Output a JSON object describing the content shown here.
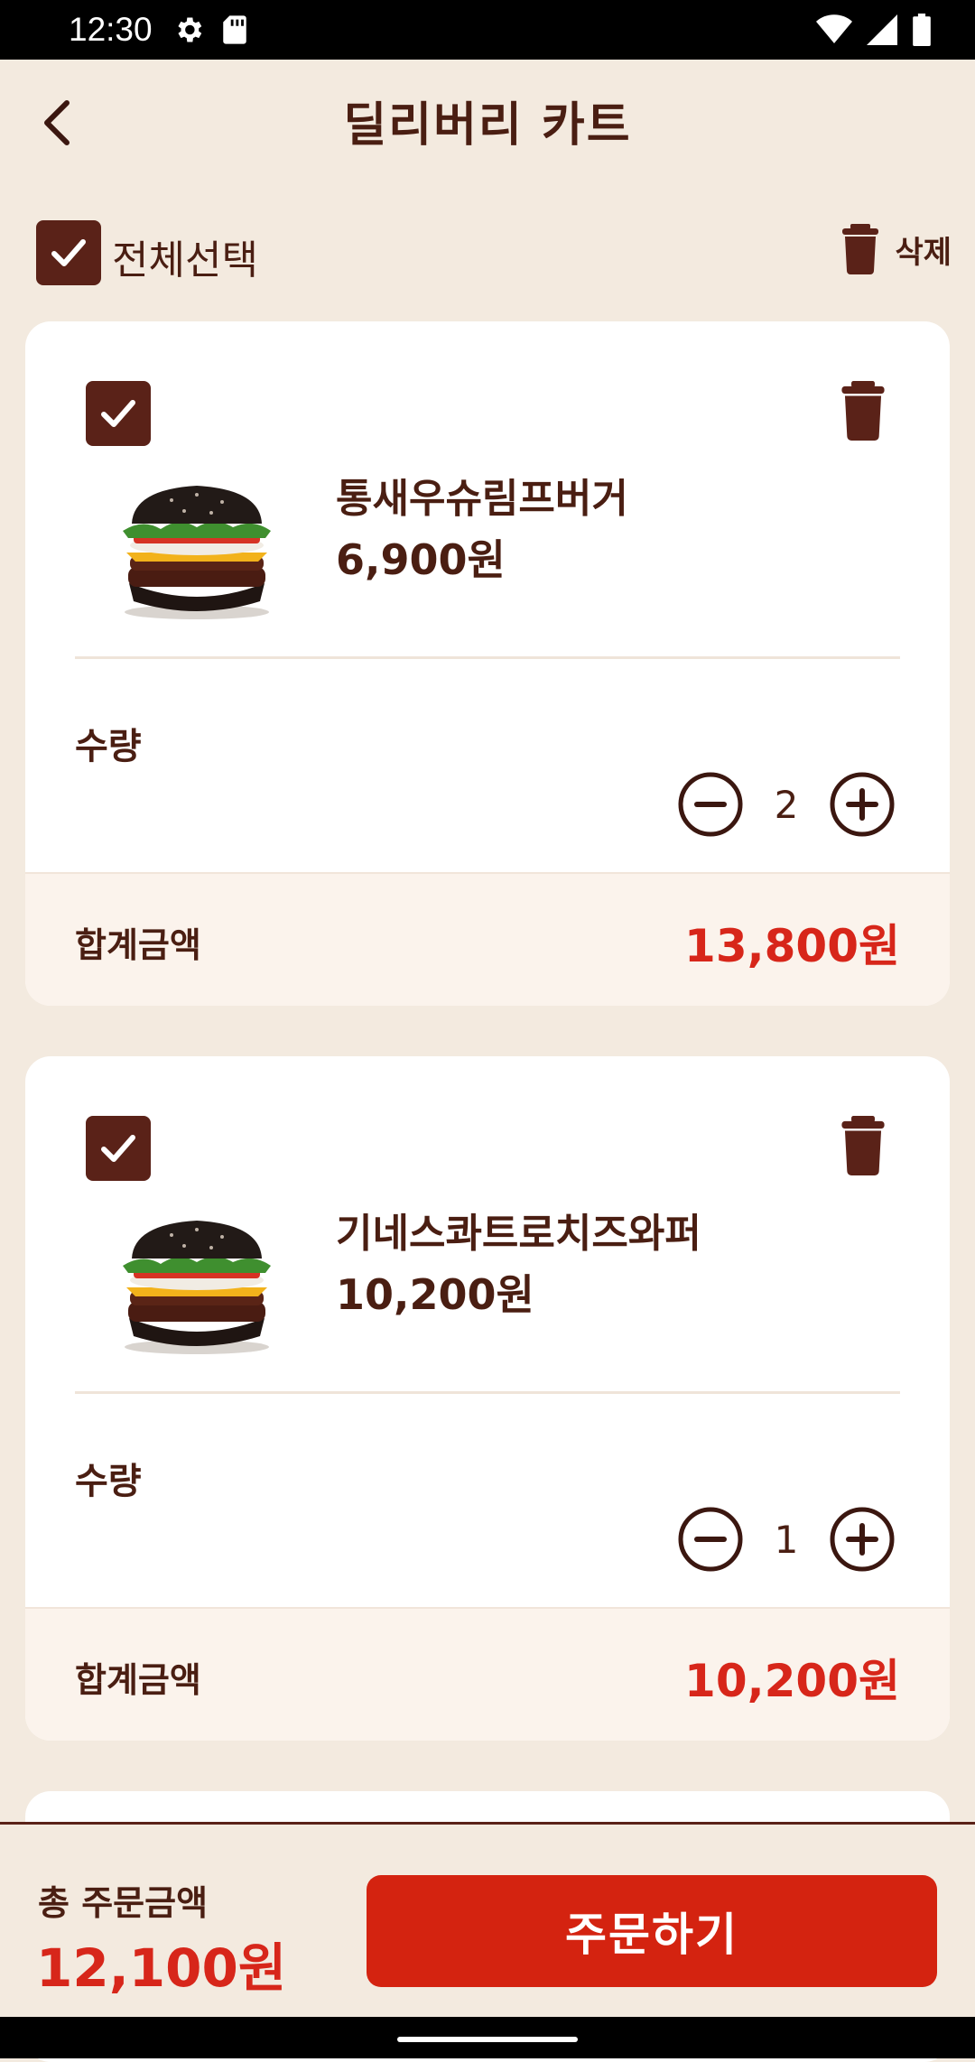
{
  "status_bar": {
    "time": "12:30",
    "icons": [
      "gear-icon",
      "sd-card-icon",
      "wifi-icon",
      "signal-icon",
      "battery-icon"
    ]
  },
  "header": {
    "title": "딜리버리 카트",
    "back_icon": "chevron-left-icon"
  },
  "select_bar": {
    "select_all_label": "전체선택",
    "select_all_checked": true,
    "delete_label": "삭제"
  },
  "cart": {
    "items": [
      {
        "checked": true,
        "name": "통새우슈림프버거",
        "price": "6,900원",
        "qty_label": "수량",
        "quantity": "2",
        "sum_label": "합계금액",
        "sum_value": "13,800원"
      },
      {
        "checked": true,
        "name": "기네스콰트로치즈와퍼",
        "price": "10,200원",
        "qty_label": "수량",
        "quantity": "1",
        "sum_label": "합계금액",
        "sum_value": "10,200원"
      }
    ]
  },
  "footer": {
    "total_label": "총 주문금액",
    "total_value": "12,100원",
    "order_button": "주문하기"
  },
  "colors": {
    "background": "#F3EADF",
    "brown": "#4A1E12",
    "accent_red": "#D42310",
    "price_red": "#D7261A"
  }
}
